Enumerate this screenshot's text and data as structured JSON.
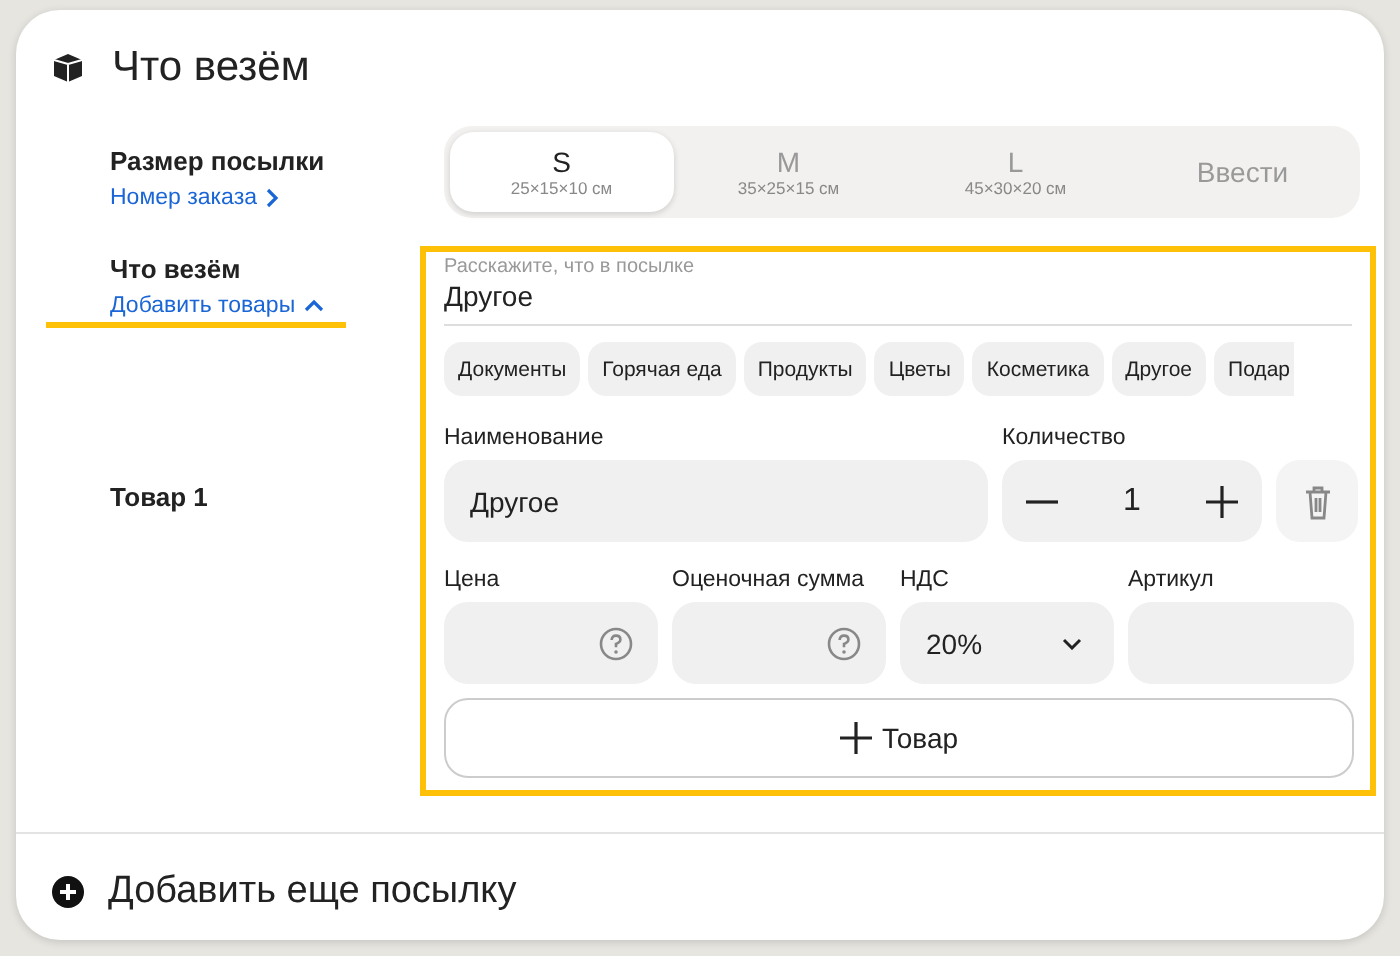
{
  "header": {
    "title": "Что везём"
  },
  "size": {
    "label": "Размер посылки",
    "link": "Номер заказа",
    "options": [
      {
        "name": "S",
        "dims": "25×15×10 см",
        "selected": true
      },
      {
        "name": "M",
        "dims": "35×25×15 см",
        "selected": false
      },
      {
        "name": "L",
        "dims": "45×30×20 см",
        "selected": false
      },
      {
        "name": "Ввести",
        "selected": false
      }
    ]
  },
  "contents": {
    "label": "Что везём",
    "link": "Добавить товары",
    "expanded": true,
    "description": {
      "label": "Расскажите, что в посылке",
      "value": "Другое"
    },
    "categories": [
      "Документы",
      "Горячая еда",
      "Продукты",
      "Цветы",
      "Косметика",
      "Другое",
      "Подар"
    ],
    "item": {
      "title": "Товар 1",
      "name_label": "Наименование",
      "name_value": "Другое",
      "quantity_label": "Количество",
      "quantity": "1",
      "price_label": "Цена",
      "estimate_label": "Оценочная сумма",
      "vat_label": "НДС",
      "vat_value": "20%",
      "article_label": "Артикул"
    },
    "add_button": "Товар"
  },
  "footer": {
    "add_parcel": "Добавить еще посылку"
  }
}
